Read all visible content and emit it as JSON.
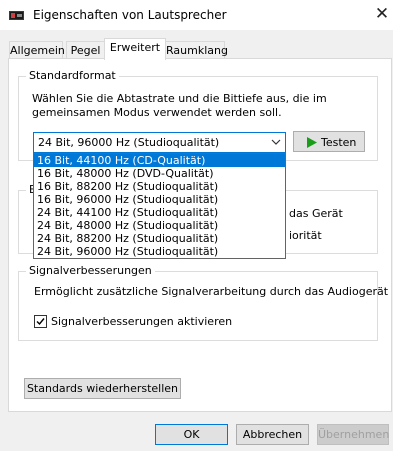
{
  "window": {
    "title": "Eigenschaften von Lautsprecher",
    "close_label": "✕"
  },
  "tabs": [
    {
      "label": "Allgemein"
    },
    {
      "label": "Pegel"
    },
    {
      "label": "Erweitert",
      "active": true
    },
    {
      "label": "Raumklang"
    }
  ],
  "standard_format": {
    "title": "Standardformat",
    "description_line1": "Wählen Sie die Abtastrate und die Bittiefe aus, die im",
    "description_line2": "gemeinsamen Modus verwendet werden soll.",
    "selected_value": "24 Bit, 96000 Hz (Studioqualität)",
    "test_button": "Testen",
    "options": [
      "16 Bit, 44100 Hz (CD-Qualität)",
      "16 Bit, 48000 Hz (DVD-Qualität)",
      "16 Bit, 88200 Hz (Studioqualität)",
      "16 Bit, 96000 Hz (Studioqualität)",
      "24 Bit, 44100 Hz (Studioqualität)",
      "24 Bit, 48000 Hz (Studioqualität)",
      "24 Bit, 88200 Hz (Studioqualität)",
      "24 Bit, 96000 Hz (Studioqualität)"
    ],
    "highlighted_option_index": 0
  },
  "exclusive_mode": {
    "title_visible": "E",
    "line1_visible": "das Gerät",
    "line2_visible": "iorität"
  },
  "signal_enhancements": {
    "title": "Signalverbesserungen",
    "description": "Ermöglicht zusätzliche Signalverarbeitung durch das Audiogerät",
    "checkbox_label": "Signalverbesserungen aktivieren",
    "checked": true
  },
  "restore_button": "Standards wiederherstellen",
  "footer": {
    "ok": "OK",
    "cancel": "Abbrechen",
    "apply": "Übernehmen"
  },
  "colors": {
    "accent": "#0078d7",
    "play_green": "#1a9e1a"
  }
}
